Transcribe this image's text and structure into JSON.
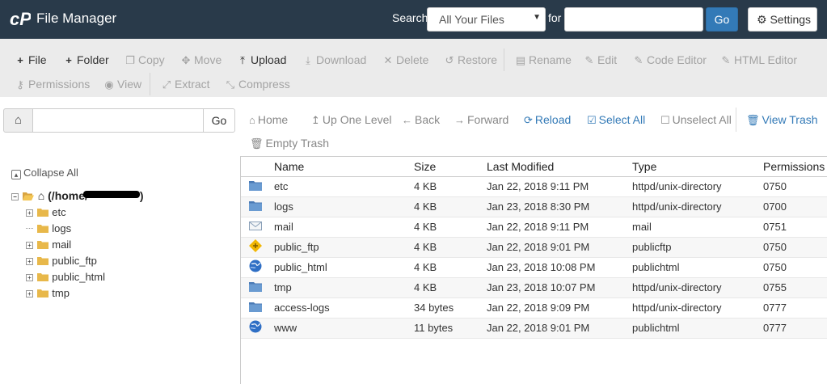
{
  "header": {
    "title": "File Manager",
    "search_label": "Search",
    "search_scope": "All Your Files",
    "for_label": "for",
    "search_query": "",
    "go_label": "Go",
    "settings_label": "Settings"
  },
  "toolbar": {
    "file": "File",
    "folder": "Folder",
    "copy": "Copy",
    "move": "Move",
    "upload": "Upload",
    "download": "Download",
    "delete": "Delete",
    "restore": "Restore",
    "rename": "Rename",
    "edit": "Edit",
    "code_editor": "Code Editor",
    "html_editor": "HTML Editor",
    "permissions": "Permissions",
    "view": "View",
    "extract": "Extract",
    "compress": "Compress"
  },
  "sidebar": {
    "path_value": "",
    "go_label": "Go",
    "collapse_all": "Collapse All",
    "root_label": "(/home/",
    "root_label_end": ")",
    "tree": [
      "etc",
      "logs",
      "mail",
      "public_ftp",
      "public_html",
      "tmp"
    ]
  },
  "nav": {
    "home": "Home",
    "up_one_level": "Up One Level",
    "back": "Back",
    "forward": "Forward",
    "reload": "Reload",
    "select_all": "Select All",
    "unselect_all": "Unselect All",
    "view_trash": "View Trash",
    "empty_trash": "Empty Trash"
  },
  "table": {
    "columns": [
      "Name",
      "Size",
      "Last Modified",
      "Type",
      "Permissions"
    ],
    "rows": [
      {
        "icon": "folder-icon",
        "name": "etc",
        "size": "4 KB",
        "modified": "Jan 22, 2018 9:11 PM",
        "type": "httpd/unix-directory",
        "perms": "0750"
      },
      {
        "icon": "folder-icon",
        "name": "logs",
        "size": "4 KB",
        "modified": "Jan 23, 2018 8:30 PM",
        "type": "httpd/unix-directory",
        "perms": "0700"
      },
      {
        "icon": "mail-icon",
        "name": "mail",
        "size": "4 KB",
        "modified": "Jan 22, 2018 9:11 PM",
        "type": "mail",
        "perms": "0751"
      },
      {
        "icon": "ftp-icon",
        "name": "public_ftp",
        "size": "4 KB",
        "modified": "Jan 22, 2018 9:01 PM",
        "type": "publicftp",
        "perms": "0750"
      },
      {
        "icon": "globe-icon",
        "name": "public_html",
        "size": "4 KB",
        "modified": "Jan 23, 2018 10:08 PM",
        "type": "publichtml",
        "perms": "0750"
      },
      {
        "icon": "folder-icon",
        "name": "tmp",
        "size": "4 KB",
        "modified": "Jan 23, 2018 10:07 PM",
        "type": "httpd/unix-directory",
        "perms": "0755"
      },
      {
        "icon": "folder-icon",
        "name": "access-logs",
        "size": "34 bytes",
        "modified": "Jan 22, 2018 9:09 PM",
        "type": "httpd/unix-directory",
        "perms": "0777"
      },
      {
        "icon": "globe-icon",
        "name": "www",
        "size": "11 bytes",
        "modified": "Jan 22, 2018 9:01 PM",
        "type": "publichtml",
        "perms": "0777"
      }
    ]
  },
  "colors": {
    "header_bg": "#293a4a",
    "toolbar_bg": "#ebebeb",
    "link_blue": "#337ab7",
    "disabled_grey": "#a3a3a3"
  }
}
